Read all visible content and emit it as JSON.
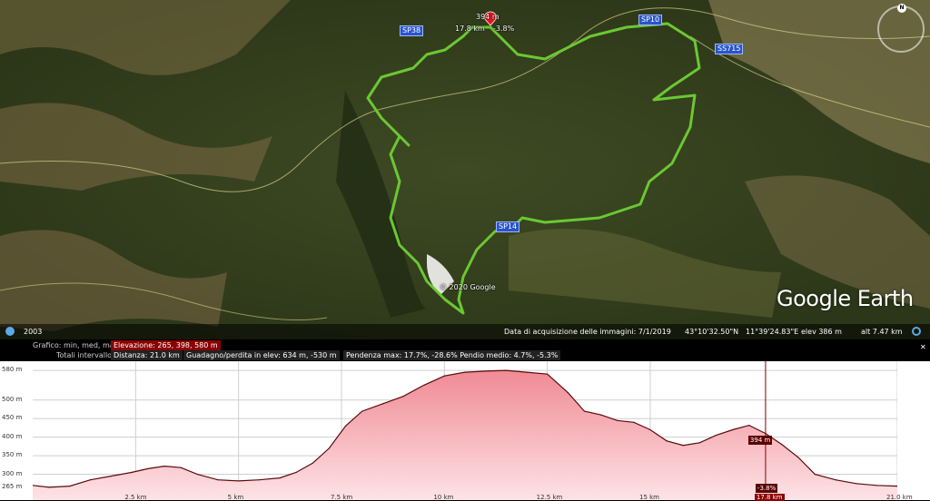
{
  "map": {
    "road_labels": [
      "SP38",
      "SP10",
      "SS715",
      "SP14"
    ],
    "track_marker": {
      "elevation": "394 m",
      "distance": "17.8 km",
      "grade": "-3.8%"
    },
    "copyright": "© 2020 Google",
    "logo": "Google Earth",
    "compass_label": "N",
    "colors": {
      "track": "#6ac832",
      "marker": "#e8121c",
      "road_label_bg": "#2a55c9"
    }
  },
  "status_bar": {
    "year": "2003",
    "capture_date": "Data di acquisizione delle immagini: 7/1/2019",
    "lat": "43°10'32.50\"N",
    "lon": "11°39'24.83\"E",
    "elev": "elev  386 m",
    "alt": "alt   7.47 km"
  },
  "profile_panel": {
    "row1_label": "Grafico: min, med, max",
    "row1_value": "Elevazione: 265, 398, 580 m",
    "row2_label": "Totali intervallo:",
    "distance": "Distanza: 21.0 km",
    "gain_loss": "Guadagno/perdita in elev: 634 m, -530 m",
    "slope": "Pendenza max: 17.7%, -28.6%  Pendio medio: 4.7%, -5.3%",
    "close_icon": "close-icon",
    "marker_elev": "394 m",
    "marker_grade": "-3.8%",
    "marker_dist": "17.8 km"
  },
  "chart_data": {
    "type": "area",
    "xlabel": "",
    "ylabel": "",
    "xlim": [
      0,
      21
    ],
    "ylim": [
      250,
      590
    ],
    "y_ticks": [
      "580 m",
      "500 m",
      "450 m",
      "400 m",
      "350 m",
      "300 m",
      "265 m"
    ],
    "y_tick_values": [
      580,
      500,
      450,
      400,
      350,
      300,
      265
    ],
    "x_ticks": [
      "2.5 km",
      "5 km",
      "7.5 km",
      "10 km",
      "12.5 km",
      "15 km",
      "17.8 km",
      "21.0 km"
    ],
    "x_tick_values": [
      2.5,
      5,
      7.5,
      10,
      12.5,
      15,
      17.8,
      21.0
    ],
    "x": [
      0,
      0.4,
      0.9,
      1.4,
      1.9,
      2.4,
      2.8,
      3.2,
      3.6,
      4.0,
      4.5,
      5.0,
      5.5,
      6.0,
      6.4,
      6.8,
      7.2,
      7.6,
      8.0,
      8.5,
      9.0,
      9.5,
      10.0,
      10.5,
      11.0,
      11.5,
      12.0,
      12.5,
      13.0,
      13.4,
      13.8,
      14.2,
      14.6,
      15.0,
      15.4,
      15.8,
      16.2,
      16.6,
      17.0,
      17.4,
      17.8,
      18.2,
      18.6,
      19.0,
      19.5,
      20.0,
      20.5,
      21.0
    ],
    "series": [
      {
        "values": [
          270,
          265,
          268,
          285,
          295,
          305,
          315,
          322,
          318,
          300,
          285,
          282,
          285,
          290,
          305,
          330,
          370,
          430,
          470,
          490,
          510,
          540,
          565,
          575,
          578,
          580,
          575,
          570,
          520,
          470,
          460,
          445,
          440,
          420,
          390,
          378,
          385,
          405,
          420,
          432,
          410,
          380,
          345,
          300,
          285,
          275,
          270,
          268
        ]
      }
    ],
    "grid": true,
    "colors": {
      "line": "#5a0a0a",
      "fill_top": "#f08a94",
      "fill_bottom": "#fde3e6",
      "grid": "#cfcfcf",
      "cursor": "#8b0000"
    }
  }
}
